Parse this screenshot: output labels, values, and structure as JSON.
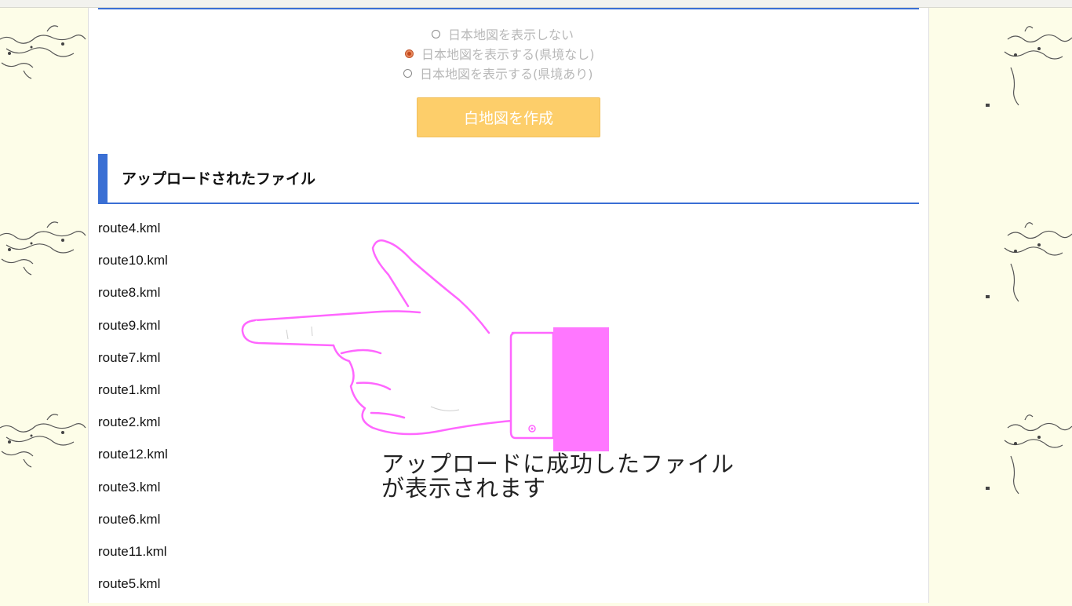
{
  "map_options": [
    {
      "label": "日本地図を表示しない",
      "checked": false
    },
    {
      "label": "日本地図を表示する(県境なし)",
      "checked": true
    },
    {
      "label": "日本地図を表示する(県境あり)",
      "checked": false
    }
  ],
  "create_button_label": "白地図を作成",
  "uploaded_section": {
    "title": "アップロードされたファイル",
    "files": [
      "route4.kml",
      "route10.kml",
      "route8.kml",
      "route9.kml",
      "route7.kml",
      "route1.kml",
      "route2.kml",
      "route12.kml",
      "route3.kml",
      "route6.kml",
      "route11.kml",
      "route5.kml"
    ]
  },
  "annotation": {
    "line1": "アップロードに成功したファイル",
    "line2": "が表示されます",
    "hand_icon": "pointing-hand-icon",
    "hand_color": "#ff77ff"
  },
  "colors": {
    "accent": "#3a6fd4",
    "button": "#fdce6a",
    "background": "#fdfde8"
  }
}
